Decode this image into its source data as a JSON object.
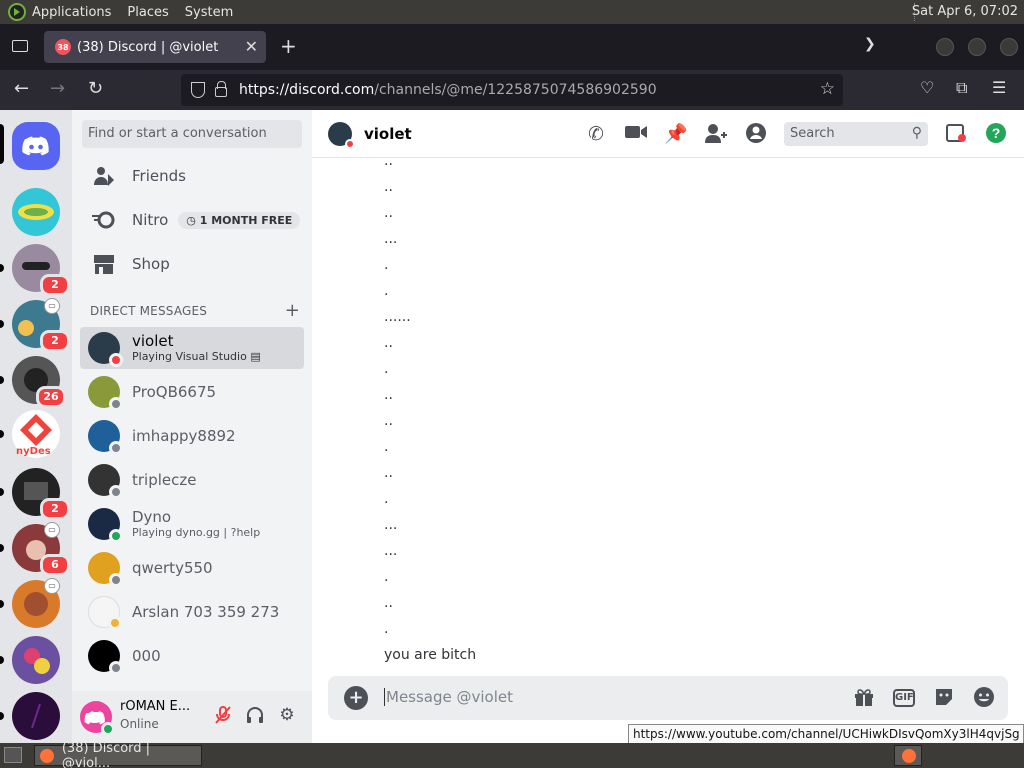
{
  "system_panel": {
    "menus": [
      "Applications",
      "Places",
      "System"
    ],
    "clock": "Sat Apr  6, 07:02"
  },
  "browser": {
    "tab_title": "(38) Discord | @violet",
    "tab_badge": "38",
    "url_host": "https://discord.com",
    "url_path": "/channels/@me/1225875074586902590",
    "status_tooltip": "https://www.youtube.com/channel/UCHiwkDIsvQomXy3lH4qvjSg"
  },
  "taskbar": {
    "window_label": "(38) Discord | @viol..."
  },
  "guilds": [
    {
      "name": "home",
      "badge": "",
      "color": "#5865f2"
    },
    {
      "name": "server-1",
      "badge": "",
      "color": "#33c6d6"
    },
    {
      "name": "server-2",
      "badge": "2",
      "color": "#9a8aa0"
    },
    {
      "name": "server-3",
      "badge": "2",
      "color": "#3d7a8f"
    },
    {
      "name": "server-4",
      "badge": "26",
      "color": "#555555"
    },
    {
      "name": "server-5",
      "badge": "",
      "color": "#f04a3a",
      "text": "nyDes"
    },
    {
      "name": "server-6",
      "badge": "2",
      "color": "#222222"
    },
    {
      "name": "server-7",
      "badge": "6",
      "color": "#8a3a3a"
    },
    {
      "name": "server-8",
      "badge": "",
      "color": "#d97a2a"
    },
    {
      "name": "server-9",
      "badge": "",
      "color": "#6b4fa0"
    },
    {
      "name": "server-10",
      "badge": "",
      "color": "#2a0d3a"
    }
  ],
  "dm_sidebar": {
    "search_placeholder": "Find or start a conversation",
    "nav": [
      {
        "label": "Friends",
        "icon": "friends-icon"
      },
      {
        "label": "Nitro",
        "icon": "nitro-icon",
        "badge": "1 MONTH FREE"
      },
      {
        "label": "Shop",
        "icon": "shop-icon"
      }
    ],
    "section_title": "DIRECT MESSAGES",
    "dms": [
      {
        "name": "violet",
        "sub": "Playing Visual Studio",
        "status": "dnd",
        "color": "#2a3b4a",
        "selected": true
      },
      {
        "name": "ProQB6675",
        "sub": "",
        "status": "offline",
        "color": "#8a9a3a"
      },
      {
        "name": "imhappy8892",
        "sub": "",
        "status": "offline",
        "color": "#1f5f9a"
      },
      {
        "name": "triplecze",
        "sub": "",
        "status": "offline",
        "color": "#333333"
      },
      {
        "name": "Dyno",
        "sub": "Playing dyno.gg | ?help",
        "status": "online",
        "color": "#1a2a44"
      },
      {
        "name": "qwerty550",
        "sub": "",
        "status": "offline",
        "color": "#e0a020"
      },
      {
        "name": "Arslan 703 359 273",
        "sub": "",
        "status": "idle",
        "color": "#f5f5f5"
      },
      {
        "name": "000",
        "sub": "",
        "status": "offline",
        "color": "#000000"
      }
    ],
    "user": {
      "name": "rOMAN E...",
      "status": "Online"
    }
  },
  "chat": {
    "channel_name": "violet",
    "search_placeholder": "Search",
    "messages": [
      "..",
      "..",
      "..",
      "...",
      ".",
      ".",
      "......",
      "..",
      ".",
      "..",
      "..",
      ".",
      "..",
      ".",
      "...",
      "...",
      ".",
      "..",
      ".",
      "you are bitch"
    ],
    "composer_placeholder": "Message @violet",
    "gif_label": "GIF"
  }
}
